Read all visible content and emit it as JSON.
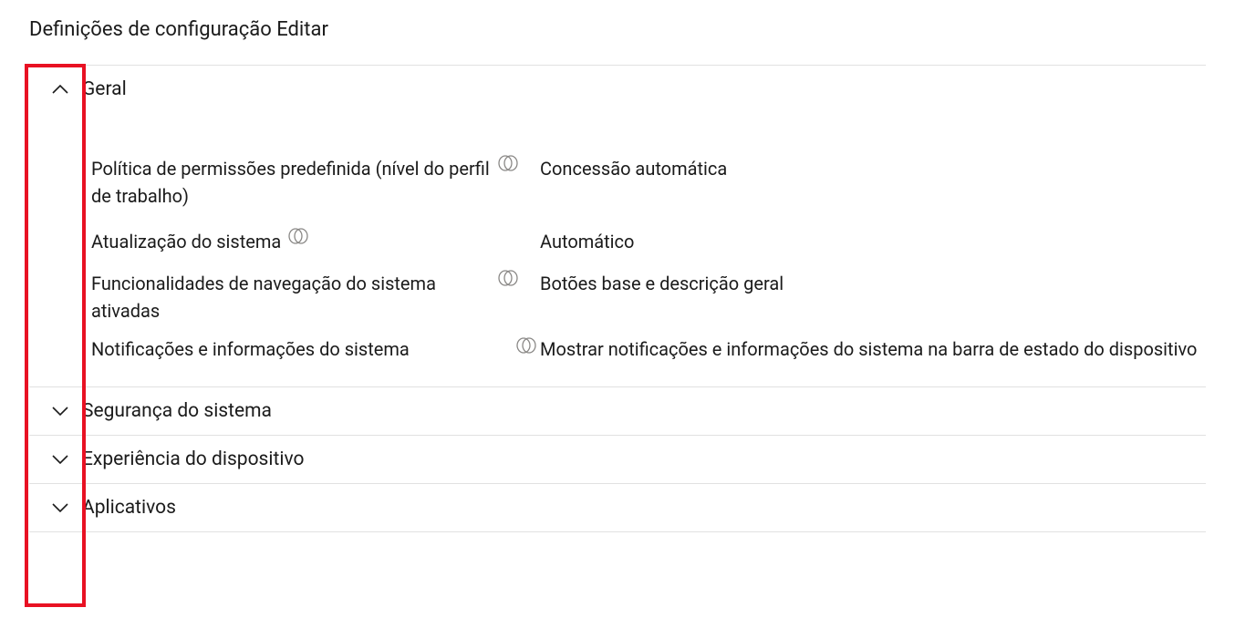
{
  "title": "Definições de configuração Editar",
  "sections": {
    "general": {
      "title": "Geral",
      "expanded": true
    },
    "systemSecurity": {
      "title": "Segurança do sistema",
      "expanded": false
    },
    "deviceExperience": {
      "title": "Experiência do dispositivo",
      "expanded": false
    },
    "apps": {
      "title": "Aplicativos",
      "expanded": false
    }
  },
  "general": {
    "rows": {
      "defaultPermission": {
        "label": "Política de permissões predefinida (nível do perfil de trabalho)",
        "value": "Concessão automática"
      },
      "systemUpdate": {
        "label": "Atualização do sistema",
        "value": "Automático"
      },
      "navFeatures": {
        "label": "Funcionalidades de navegação do sistema ativadas",
        "value": "Botões base e descrição geral"
      },
      "notifications": {
        "label": "Notificações e informações do sistema",
        "value": "Mostrar notificações e informações do sistema na barra de estado do dispositivo"
      }
    }
  }
}
